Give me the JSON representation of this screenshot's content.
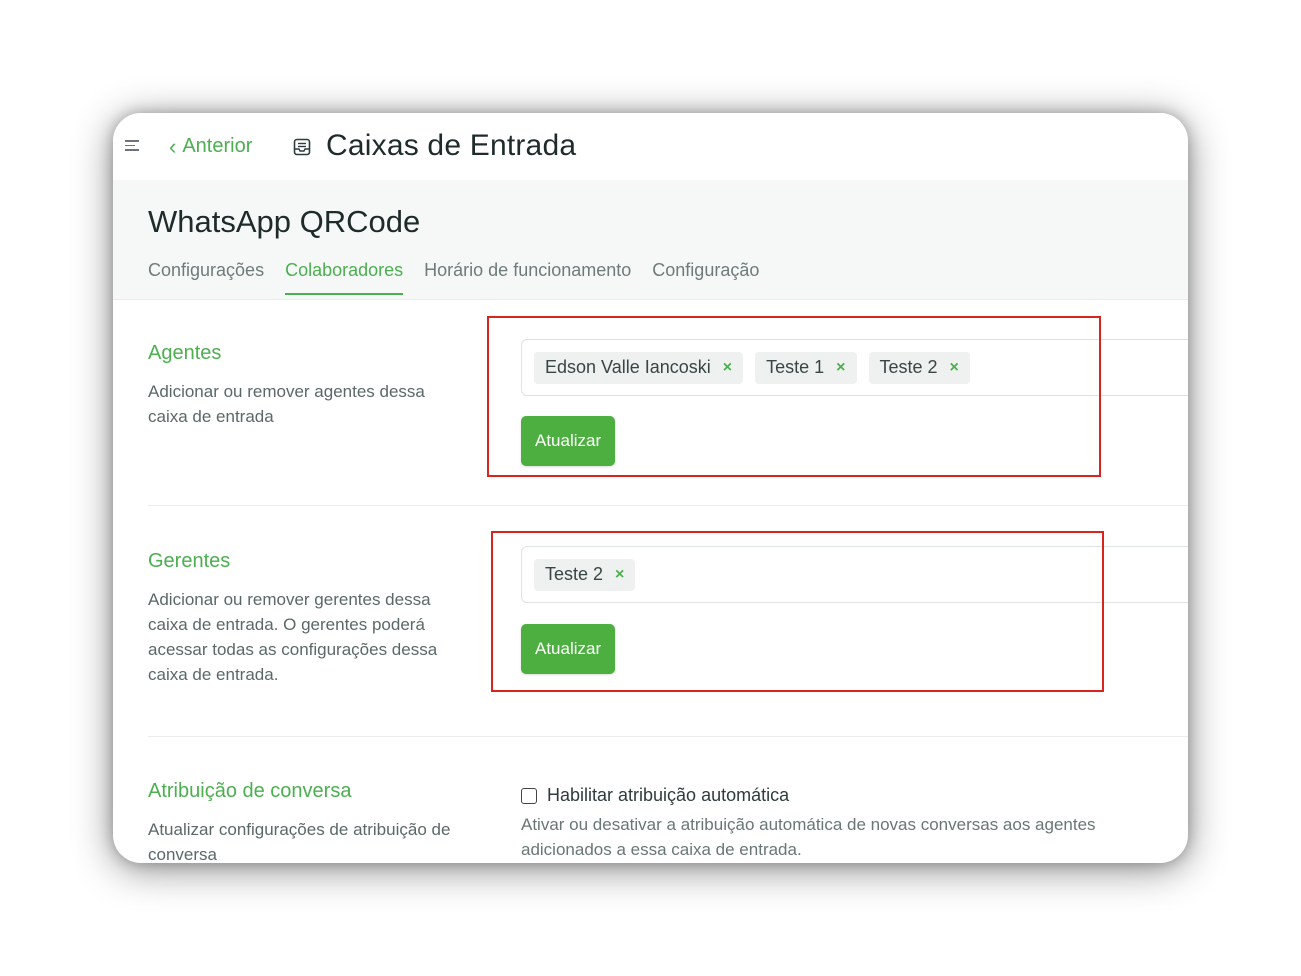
{
  "topbar": {
    "back_label": "Anterior",
    "page_title": "Caixas de Entrada"
  },
  "header": {
    "inbox_name": "WhatsApp QRCode",
    "tabs": [
      {
        "label": "Configurações",
        "active": false
      },
      {
        "label": "Colaboradores",
        "active": true
      },
      {
        "label": "Horário de funcionamento",
        "active": false
      },
      {
        "label": "Configuração",
        "active": false
      }
    ]
  },
  "agents": {
    "title": "Agentes",
    "description": "Adicionar ou remover agentes dessa caixa de entrada",
    "selected": [
      "Edson Valle Iancoski",
      "Teste 1",
      "Teste 2"
    ],
    "button_label": "Atualizar"
  },
  "managers": {
    "title": "Gerentes",
    "description": "Adicionar ou remover gerentes dessa caixa de entrada. O gerentes poderá acessar todas as configurações dessa caixa de entrada.",
    "selected": [
      "Teste 2"
    ],
    "button_label": "Atualizar"
  },
  "assignment": {
    "title": "Atribuição de conversa",
    "description": "Atualizar configurações de atribuição de conversa",
    "checkbox_label": "Habilitar atribuição automática",
    "checkbox_checked": false,
    "help_text": "Ativar ou desativar a atribuição automática de novas conversas aos agentes adicionados a essa caixa de entrada."
  },
  "colors": {
    "accent": "#4caf50",
    "button": "#4caf3f",
    "highlight": "#d9231d"
  },
  "icons": [
    "menu-icon",
    "chevron-left-icon",
    "inbox-icon",
    "close-icon"
  ]
}
